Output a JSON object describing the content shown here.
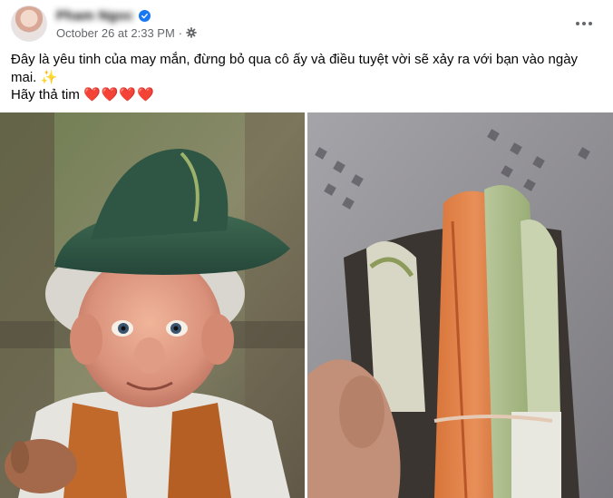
{
  "post": {
    "author": "Pham Ngoc",
    "timestamp": "October 26 at 2:33 PM",
    "separator": "·",
    "caption_line1": "Đây là yêu tinh của may mắn, đừng bỏ qua cô ấy và điều tuyệt vời sẽ xảy ra với bạn vào ngày mai.",
    "sparkle_emoji": "✨",
    "caption_line2": "Hãy thả tim",
    "hearts": "❤️❤️❤️❤️"
  },
  "icons": {
    "verified": "verified-badge-icon",
    "privacy": "gear-icon",
    "more": "more-horizontal-icon"
  },
  "colors": {
    "meta_text": "#65676b",
    "verified_blue": "#1877f2",
    "heart_red": "#e41e3f"
  },
  "media": {
    "count": 2
  }
}
